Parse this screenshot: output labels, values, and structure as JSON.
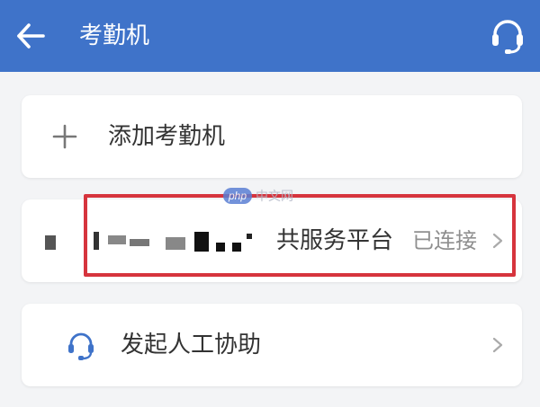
{
  "header": {
    "title": "考勤机",
    "back_icon": "back-arrow-icon",
    "support_icon": "headset-icon",
    "background_color": "#3f73c9"
  },
  "add_card": {
    "label": "添加考勤机",
    "icon": "plus-icon"
  },
  "device_card": {
    "name_visible_suffix": "共服务平台",
    "status": "已连接",
    "highlight_color": "#d6343d"
  },
  "help_card": {
    "label": "发起人工协助",
    "icon": "headset-icon"
  },
  "watermark": {
    "logo": "php",
    "text": "中文网"
  }
}
